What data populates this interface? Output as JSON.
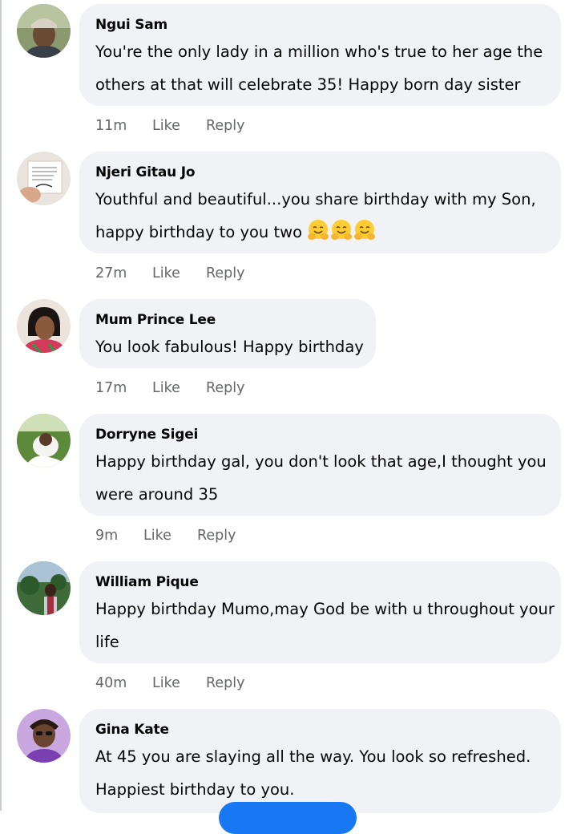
{
  "comments": [
    {
      "author": "Ngui Sam",
      "line1": "You're the only lady in a million who's true to her age the",
      "line2": "others at that will celebrate 35! Happy born day sister",
      "time": "11m",
      "like": "Like",
      "reply": "Reply"
    },
    {
      "author": "Njeri Gitau Jo",
      "line1": "Youthful and beautiful...you share birthday with my Son,",
      "line2": "happy birthday to you two",
      "emoji": [
        "hugging-face-emoji",
        "hugging-face-emoji",
        "hugging-face-emoji"
      ],
      "time": "27m",
      "like": "Like",
      "reply": "Reply"
    },
    {
      "author": "Mum Prince Lee",
      "line1": "You look fabulous! Happy birthday",
      "time": "17m",
      "like": "Like",
      "reply": "Reply"
    },
    {
      "author": "Dorryne Sigei",
      "line1": "Happy birthday gal, you don't look that age,I thought you",
      "line2": "were around 35",
      "time": "9m",
      "like": "Like",
      "reply": "Reply"
    },
    {
      "author": "William Pique",
      "line1": "Happy birthday Mumo,may God be with u throughout your",
      "line2": "life",
      "time": "40m",
      "like": "Like",
      "reply": "Reply"
    },
    {
      "author": "Gina Kate",
      "line1": "At 45 you are slaying all the way. You look so refreshed.",
      "line2": "Happiest birthday to you.",
      "time": "",
      "like": "",
      "reply": ""
    }
  ],
  "colors": {
    "bubble": "#f0f2f5",
    "meta": "#65676b",
    "text": "#050505",
    "accent": "#1877f2"
  }
}
